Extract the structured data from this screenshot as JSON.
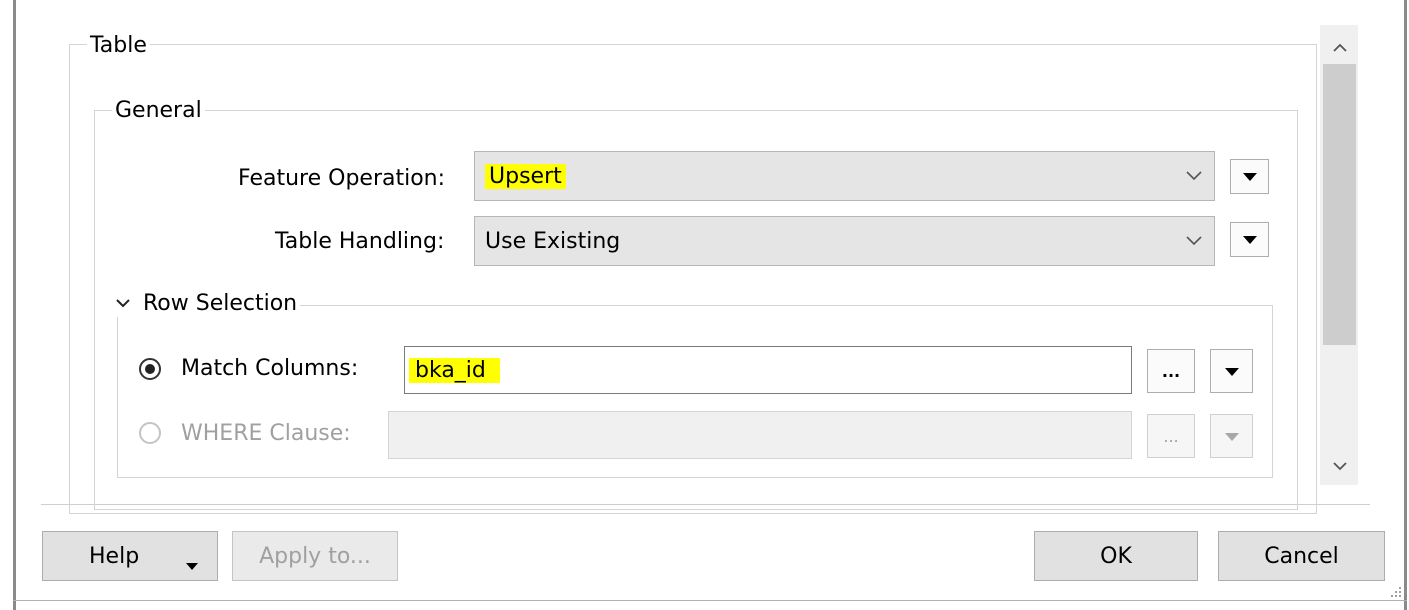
{
  "table_group": {
    "title": "Table"
  },
  "general_group": {
    "title": "General"
  },
  "feature_operation": {
    "label": "Feature Operation:",
    "value": "Upsert",
    "highlight_color": "#ffff00"
  },
  "table_handling": {
    "label": "Table Handling:",
    "value": "Use Existing"
  },
  "row_selection": {
    "title": "Row Selection",
    "match_columns": {
      "label": "Match Columns:",
      "value": "bka_id",
      "selected": true,
      "browse_label": "..."
    },
    "where_clause": {
      "label": "WHERE Clause:",
      "value": "",
      "selected": false,
      "enabled": false,
      "browse_label": "..."
    }
  },
  "footer": {
    "help_label": "Help",
    "apply_label": "Apply to...",
    "ok_label": "OK",
    "cancel_label": "Cancel"
  },
  "icons": {
    "scroll_up": "chevron-up-icon",
    "scroll_down": "chevron-down-icon",
    "combo_dropdown": "chevron-down-icon",
    "menu": "triangle-down-icon",
    "collapse": "chevron-down-icon",
    "resize": "resize-grip-icon"
  }
}
